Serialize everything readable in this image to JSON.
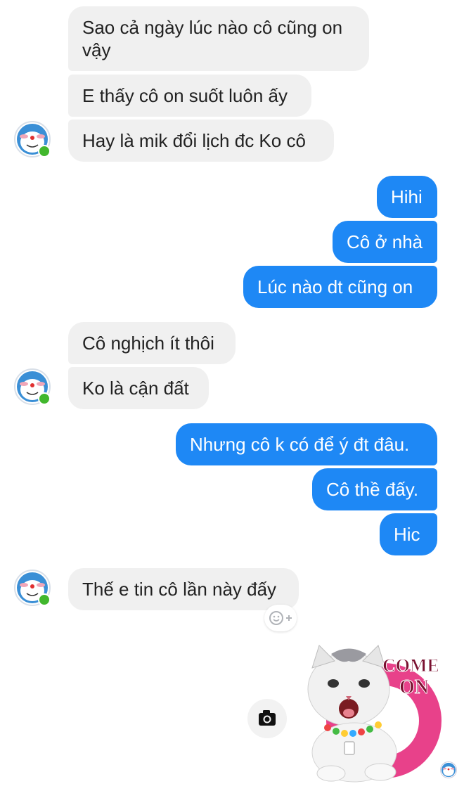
{
  "conversation": {
    "messages": [
      {
        "side": "in",
        "text": "Sao cả ngày lúc nào cô cũng on"
      },
      {
        "side": "in",
        "text": "vậy"
      },
      {
        "side": "in",
        "text": "E thấy cô on suốt luôn ấy"
      },
      {
        "side": "in",
        "text": "Hay là mik đổi lịch đc Ko cô"
      },
      {
        "side": "out",
        "text": "Hihi"
      },
      {
        "side": "out",
        "text": "Cô ở nhà"
      },
      {
        "side": "out",
        "text": "Lúc nào dt cũng on"
      },
      {
        "side": "in",
        "text": "Cô nghịch ít thôi"
      },
      {
        "side": "in",
        "text": "Ko là cận đất"
      },
      {
        "side": "out",
        "text": "Nhưng cô k có để ý đt đâu."
      },
      {
        "side": "out",
        "text": "Cô thề đấy."
      },
      {
        "side": "out",
        "text": "Hic"
      },
      {
        "side": "in",
        "text": "Thế e tin cô lần này đấy"
      }
    ],
    "sticker": {
      "description": "cat sticker",
      "text_line1": "COME",
      "text_line2": "ON"
    },
    "icons": {
      "avatar": "doraemon-avatar-icon",
      "reaction": "add-reaction-icon",
      "camera": "camera-icon",
      "seen": "seen-avatar-icon"
    },
    "colors": {
      "outgoing": "#1e88f5",
      "incoming": "#f0f0f0",
      "online": "#41b72d",
      "sticker_pink": "#e8418a"
    }
  }
}
